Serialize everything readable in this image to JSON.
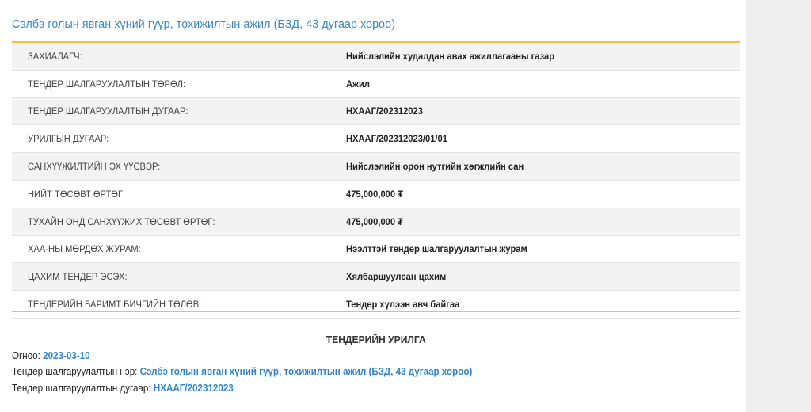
{
  "title": "Сэлбэ голын явган хүний гүүр, тохижилтын ажил (БЗД, 43 дугаар хороо)",
  "details": [
    {
      "label": "ЗАХИАЛАГЧ:",
      "value": "Нийслэлийн худалдан авах ажиллагааны газар"
    },
    {
      "label": "ТЕНДЕР ШАЛГАРУУЛАЛТЫН ТӨРӨЛ:",
      "value": "Ажил"
    },
    {
      "label": "ТЕНДЕР ШАЛГАРУУЛАЛТЫН ДУГААР:",
      "value": "НХААГ/202312023"
    },
    {
      "label": "УРИЛГЫН ДУГААР:",
      "value": "НХААГ/202312023/01/01"
    },
    {
      "label": "САНХҮҮЖИЛТИЙН ЭХ ҮҮСВЭР:",
      "value": "Нийслэлийн орон нутгийн хөгжлийн сан"
    },
    {
      "label": "НИЙТ ТӨСӨВТ ӨРТӨГ:",
      "value": "475,000,000 ₮"
    },
    {
      "label": "ТУХАЙН ОНД САНХҮҮЖИХ ТӨСӨВТ ӨРТӨГ:",
      "value": "475,000,000 ₮"
    },
    {
      "label": "ХАА-НЫ МӨРДӨХ ЖУРАМ:",
      "value": "Нээлттэй тендер шалгаруулалтын журам"
    },
    {
      "label": "ЦАХИМ ТЕНДЕР ЭСЭХ:",
      "value": "Хялбаршуулсан цахим"
    },
    {
      "label": "ТЕНДЕРИЙН БАРИМТ БИЧГИЙН ТӨЛӨВ:",
      "value": "Тендер хүлээн авч байгаа"
    }
  ],
  "invitation": {
    "heading": "ТЕНДЕРИЙН УРИЛГА",
    "date_label": "Огноо:",
    "date_value": "2023-03-10",
    "name_label": "Тендер шалгаруулалтын нэр:",
    "name_value": "Сэлбэ голын явган хүний гүүр, тохижилтын ажил (БЗД, 43 дугаар хороо)",
    "number_label": "Тендер шалгаруулалтын дугаар:",
    "number_value": "НХААГ/202312023"
  },
  "colors": {
    "accent_blue": "#3a87c5",
    "rule_yellow": "#f0c03f",
    "stripe_gray": "#f3f3f3"
  }
}
